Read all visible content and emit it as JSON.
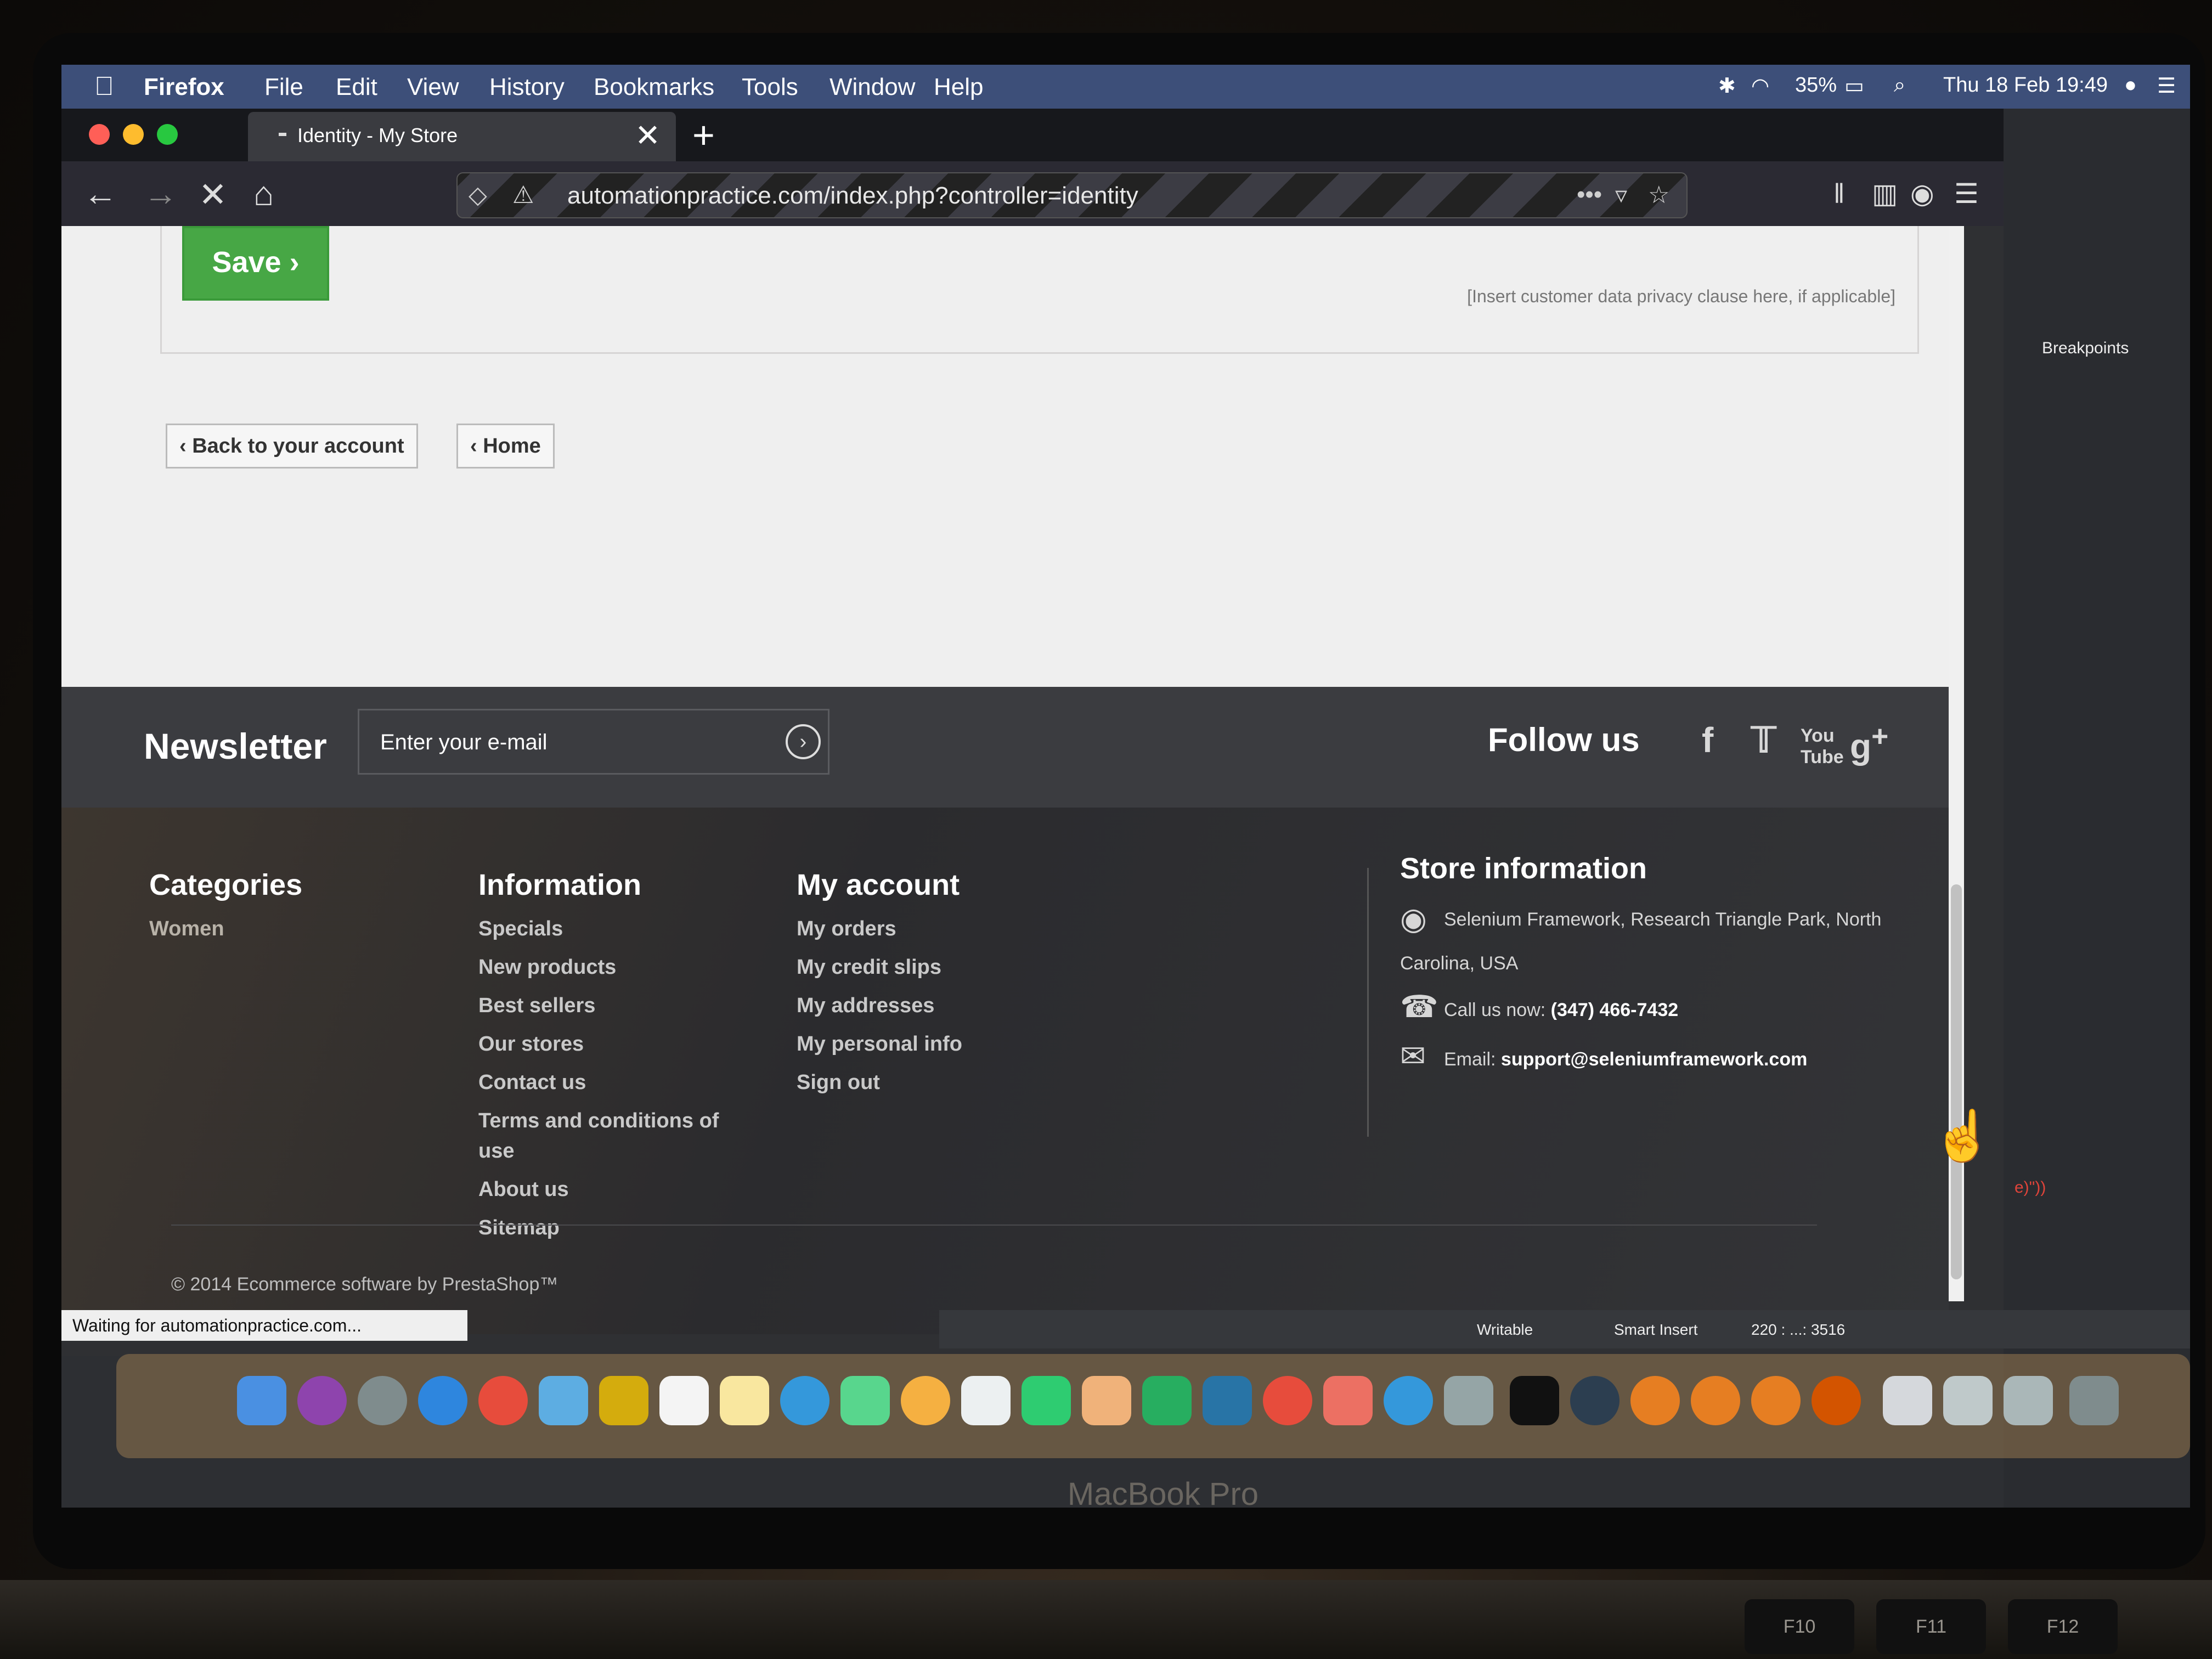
{
  "menubar": {
    "app": "Firefox",
    "items": [
      "File",
      "Edit",
      "View",
      "History",
      "Bookmarks",
      "Tools",
      "Window",
      "Help"
    ],
    "battery": "35%",
    "datetime": "Thu 18 Feb  19:49"
  },
  "tab": {
    "title": "Identity - My Store"
  },
  "urlbar": {
    "url": "automationpractice.com/index.php?controller=identity"
  },
  "content": {
    "save_label": "Save",
    "privacy_note": "[Insert customer data privacy clause here, if applicable]",
    "back_to_account_label": "Back to your account",
    "home_label": "Home"
  },
  "newsletter": {
    "title": "Newsletter",
    "placeholder": "Enter your e-mail"
  },
  "follow": {
    "title": "Follow us"
  },
  "footer": {
    "categories": {
      "title": "Categories",
      "items": [
        "Women"
      ]
    },
    "information": {
      "title": "Information",
      "items": [
        "Specials",
        "New products",
        "Best sellers",
        "Our stores",
        "Contact us",
        "Terms and conditions of",
        "use",
        "About us",
        "Sitemap"
      ]
    },
    "my_account": {
      "title": "My account",
      "items": [
        "My orders",
        "My credit slips",
        "My addresses",
        "My personal info",
        "Sign out"
      ]
    },
    "store_information": {
      "title": "Store information",
      "address_line1": "Selenium Framework, Research Triangle Park, North",
      "address_line2": "Carolina, USA",
      "call_label": "Call us now: ",
      "phone": "(347) 466-7432",
      "email_label": "Email: ",
      "email": "support@seleniumframework.com"
    },
    "copyright": "© 2014 Ecommerce software by PrestaShop™"
  },
  "status_bar": {
    "text": "Waiting for automationpractice.com..."
  },
  "ide": {
    "breakpoints_label": "Breakpoints",
    "code_fragment": "e)\"))",
    "writable": "Writable",
    "insert_mode": "Smart Insert",
    "position": "220 : ...: 3516"
  },
  "laptop": {
    "model": "MacBook Pro",
    "keys": [
      "F10",
      "F11",
      "F12"
    ]
  },
  "colors": {
    "save_green": "#47a745",
    "footer_dark": "#3b3c40",
    "menubar_blue": "#3d4f79"
  }
}
